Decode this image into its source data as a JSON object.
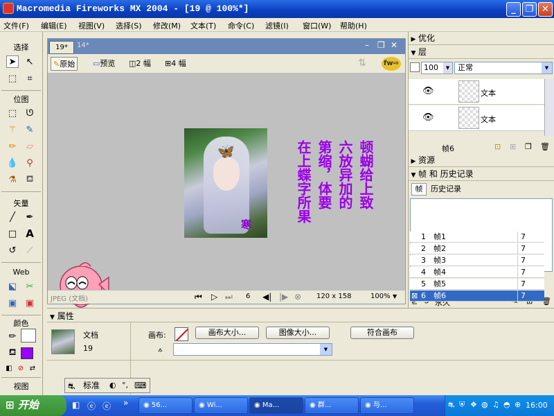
{
  "window": {
    "title": "Macromedia Fireworks MX 2004 - [19 @ 100%*]"
  },
  "menu": [
    "文件(F)",
    "编辑(E)",
    "视图(V)",
    "选择(S)",
    "修改(M)",
    "文本(T)",
    "命令(C)",
    "滤镜(I)",
    "窗口(W)",
    "帮助(H)"
  ],
  "tools": {
    "sections": [
      "选择",
      "位图",
      "矢量",
      "Web",
      "颜色",
      "视图"
    ]
  },
  "document": {
    "tabs": [
      "19*",
      "14*"
    ],
    "views": [
      "原始",
      "预览",
      "2 幅",
      "4 幅"
    ],
    "canvas_text": {
      "columns": [
        "在上蝶字所果",
        "第缩，体要",
        "六放异加的",
        "顿蝴给上致"
      ]
    },
    "image_char": "寒",
    "status": {
      "format": "JPEG (文档)",
      "frame": "6",
      "size": "120 x 158",
      "zoom": "100%"
    }
  },
  "panels": {
    "optimize": "优化",
    "layers": {
      "title": "层",
      "opacity": "100",
      "blend": "正常",
      "items": [
        "文本",
        "文本"
      ],
      "frame_label": "帧6"
    },
    "assets": "资源",
    "frames_history": {
      "title": "帧 和 历史记录",
      "tabs": [
        "帧",
        "历史记录"
      ],
      "frames": [
        {
          "num": "1",
          "name": "帧1",
          "delay": "7"
        },
        {
          "num": "2",
          "name": "帧2",
          "delay": "7"
        },
        {
          "num": "3",
          "name": "帧3",
          "delay": "7"
        },
        {
          "num": "4",
          "name": "帧4",
          "delay": "7"
        },
        {
          "num": "5",
          "name": "帧5",
          "delay": "7"
        },
        {
          "num": "6",
          "name": "帧6",
          "delay": "7"
        }
      ],
      "loop": "永久"
    }
  },
  "properties": {
    "title": "属性",
    "doc_label": "文档",
    "doc_name": "19",
    "canvas_label": "画布:",
    "btn_canvas_size": "画布大小...",
    "btn_image_size": "图像大小...",
    "btn_fit_canvas": "符合画布"
  },
  "ime": {
    "mode": "标准"
  },
  "taskbar": {
    "start": "开始",
    "items": [
      "56...",
      "Wi...",
      "Ma...",
      "群...",
      "与..."
    ],
    "clock": "16:00"
  }
}
